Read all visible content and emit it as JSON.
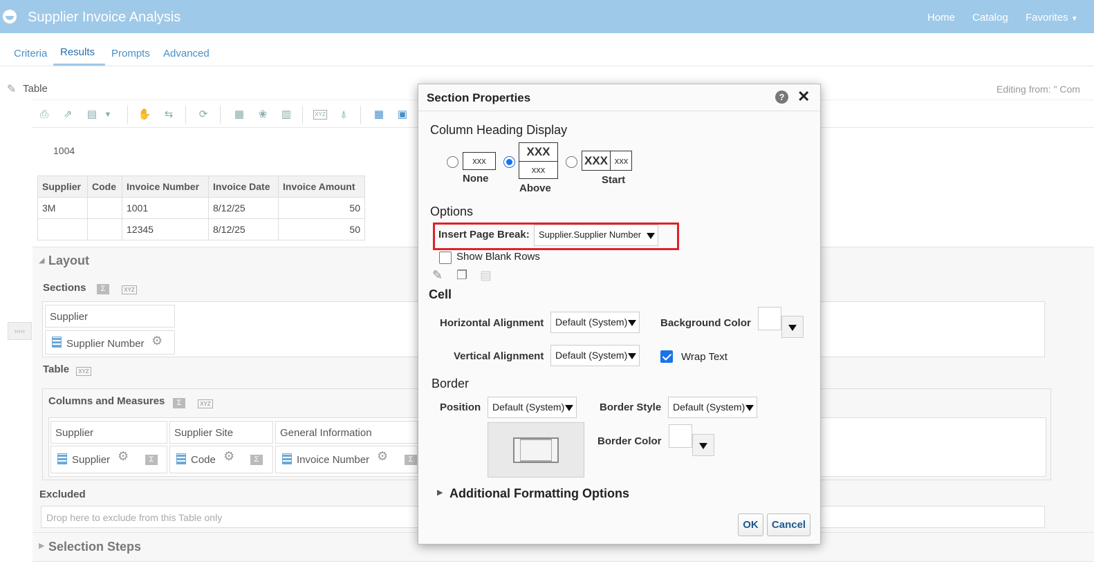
{
  "app": {
    "title": "Supplier Invoice Analysis"
  },
  "topnav": {
    "home": "Home",
    "catalog": "Catalog",
    "favorites": "Favorites"
  },
  "tabs": [
    "Criteria",
    "Results",
    "Prompts",
    "Advanced"
  ],
  "editor": {
    "view_label": "Table",
    "editing_from": "Editing from: \" Com"
  },
  "section_value": "1004",
  "result_table": {
    "headers": [
      "Supplier",
      "Code",
      "Invoice Number",
      "Invoice Date",
      "Invoice Amount"
    ],
    "rows": [
      [
        "3M",
        "",
        "1001",
        "8/12/25",
        "50"
      ],
      [
        "",
        "",
        "12345",
        "8/12/25",
        "50"
      ]
    ]
  },
  "layout": {
    "title": "Layout",
    "sections_label": "Sections",
    "sections_header": "Supplier",
    "sections_item": "Supplier Number",
    "table_label": "Table",
    "columns_label": "Columns and Measures",
    "columns": [
      {
        "header": "Supplier",
        "item": "Supplier"
      },
      {
        "header": "Supplier Site",
        "item": "Code"
      },
      {
        "header": "General Information",
        "item": "Invoice Number"
      }
    ],
    "excluded_label": "Excluded",
    "excluded_placeholder": "Drop here to exclude from this Table only",
    "selection_steps": "Selection Steps"
  },
  "icons": {
    "sigma": "Σ",
    "xyz": "XYZ"
  },
  "dialog": {
    "title": "Section Properties",
    "help": "?",
    "close": "✕",
    "column_heading_display": "Column Heading Display",
    "heading_options": [
      {
        "label": "None",
        "sample": "xxx",
        "selected": false
      },
      {
        "label": "Above",
        "sample": "XXX",
        "sample2": "xxx",
        "selected": true
      },
      {
        "label": "Start",
        "sample": "XXX",
        "sample2": "xxx",
        "selected": false
      }
    ],
    "options_title": "Options",
    "page_break_label": "Insert Page Break:",
    "page_break_value": "Supplier.Supplier Number",
    "highlight_color": "#e0202a",
    "show_blank_rows": "Show Blank Rows",
    "cell_title": "Cell",
    "horizontal_alignment_label": "Horizontal Alignment",
    "horizontal_alignment_value": "Default (System)",
    "vertical_alignment_label": "Vertical Alignment",
    "vertical_alignment_value": "Default (System)",
    "background_color_label": "Background Color",
    "wrap_text_label": "Wrap Text",
    "wrap_text_checked": true,
    "border_title": "Border",
    "position_label": "Position",
    "position_value": "Default (System)",
    "border_style_label": "Border Style",
    "border_style_value": "Default (System)",
    "border_color_label": "Border Color",
    "additional_formatting": "Additional Formatting Options",
    "ok": "OK",
    "cancel": "Cancel"
  }
}
